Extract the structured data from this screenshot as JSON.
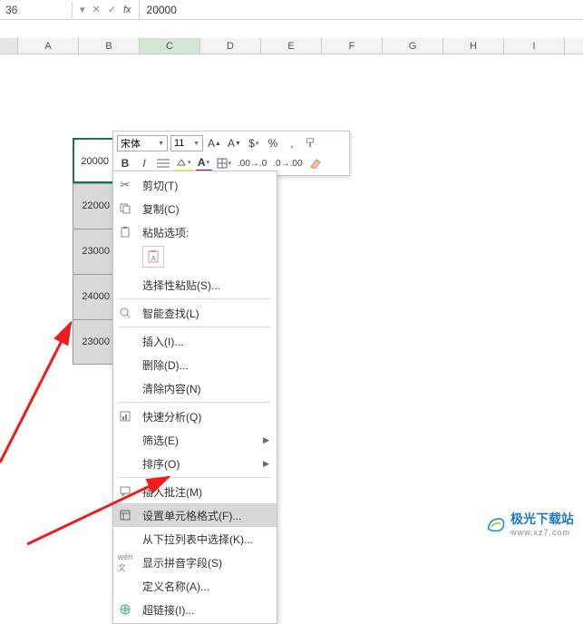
{
  "formula_bar": {
    "name_box": "36",
    "fx_label": "fx",
    "value": "20000"
  },
  "columns": [
    "A",
    "B",
    "C",
    "D",
    "E",
    "F",
    "G",
    "H",
    "I"
  ],
  "selected_col": "C",
  "data_cells": [
    "20000",
    "22000",
    "23000",
    "24000",
    "23000"
  ],
  "mini_toolbar": {
    "font_name": "宋体",
    "font_size": "11"
  },
  "context_menu": {
    "cut": "剪切(T)",
    "copy": "复制(C)",
    "paste_options_label": "粘贴选项:",
    "paste_special": "选择性粘贴(S)...",
    "smart_lookup": "智能查找(L)",
    "insert": "插入(I)...",
    "delete": "删除(D)...",
    "clear": "清除内容(N)",
    "quick_analysis": "快速分析(Q)",
    "filter": "筛选(E)",
    "sort": "排序(O)",
    "insert_comment": "插入批注(M)",
    "format_cells": "设置单元格格式(F)...",
    "pick_from_list": "从下拉列表中选择(K)...",
    "show_phonetic": "显示拼音字段(S)",
    "define_name": "定义名称(A)...",
    "hyperlink": "超链接(I)..."
  },
  "watermark": {
    "title": "极光下载站",
    "url": "www.xz7.com"
  }
}
